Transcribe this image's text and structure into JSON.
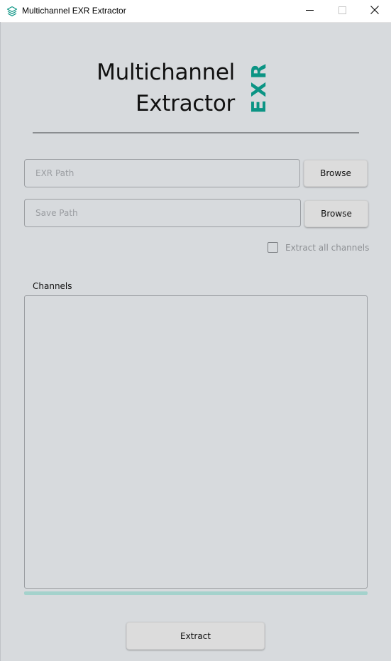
{
  "window": {
    "title": "Multichannel EXR Extractor",
    "controls": [
      "minimize",
      "maximize",
      "close"
    ]
  },
  "header": {
    "title_line1": "Multichannel",
    "title_line2": "Extractor",
    "logo_text": "EXR",
    "logo_color": "#0b9484"
  },
  "form": {
    "exr_path": {
      "placeholder": "EXR Path",
      "value": ""
    },
    "save_path": {
      "placeholder": "Save Path",
      "value": ""
    },
    "browse_label": "Browse",
    "extract_all": {
      "label": "Extract all channels",
      "checked": false
    }
  },
  "channels": {
    "label": "Channels",
    "items": []
  },
  "progress": {
    "value": 0
  },
  "actions": {
    "extract_label": "Extract"
  },
  "colors": {
    "background": "#d7dadd",
    "accent": "#0b9484",
    "progress_track": "#a4d2cc"
  }
}
